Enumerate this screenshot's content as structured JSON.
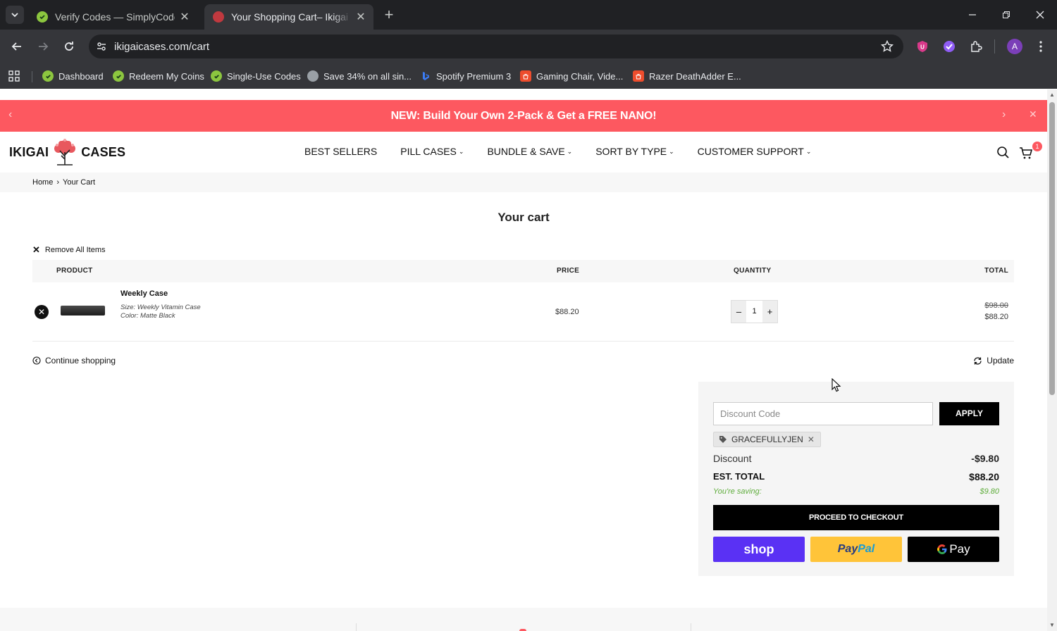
{
  "browser": {
    "tabs": [
      {
        "title": "Verify Codes — SimplyCodes",
        "active": false,
        "favicon": "simplycodes-check-icon"
      },
      {
        "title": "Your Shopping Cart– Ikigai Case",
        "active": true,
        "favicon": "ikigai-tree-icon"
      }
    ],
    "url": "ikigaicases.com/cart",
    "bookmarks": [
      {
        "label": "Dashboard",
        "icon": "simplycodes-check-icon"
      },
      {
        "label": "Redeem My Coins",
        "icon": "simplycodes-check-icon"
      },
      {
        "label": "Single-Use Codes",
        "icon": "simplycodes-check-icon"
      },
      {
        "label": "Save 34% on all sin...",
        "icon": "globe-icon"
      },
      {
        "label": "Spotify Premium 3",
        "icon": "bing-icon"
      },
      {
        "label": "Gaming Chair, Vide...",
        "icon": "shop-bag-icon"
      },
      {
        "label": "Razer DeathAdder E...",
        "icon": "shop-bag-icon"
      }
    ],
    "profile_initial": "A"
  },
  "announcement": {
    "text": "NEW: Build Your Own 2-Pack & Get a FREE NANO!"
  },
  "header": {
    "logo_left": "IKIGAI",
    "logo_right": "CASES",
    "nav": [
      {
        "label": "BEST SELLERS",
        "dropdown": false
      },
      {
        "label": "PILL CASES",
        "dropdown": true
      },
      {
        "label": "BUNDLE & SAVE",
        "dropdown": true
      },
      {
        "label": "SORT BY TYPE",
        "dropdown": true
      },
      {
        "label": "CUSTOMER SUPPORT",
        "dropdown": true
      }
    ],
    "cart_count": "1"
  },
  "breadcrumb": {
    "home": "Home",
    "sep": "›",
    "current": "Your Cart"
  },
  "cart": {
    "title": "Your cart",
    "remove_all": "Remove All Items",
    "columns": {
      "product": "PRODUCT",
      "price": "PRICE",
      "quantity": "QUANTITY",
      "total": "TOTAL"
    },
    "items": [
      {
        "name": "Weekly Case",
        "size": "Size: Weekly Vitamin Case",
        "color": "Color: Matte Black",
        "price": "$88.20",
        "quantity": "1",
        "original_total": "$98.00",
        "total": "$88.20"
      }
    ],
    "continue_shopping": "Continue shopping",
    "update": "Update"
  },
  "summary": {
    "discount_placeholder": "Discount Code",
    "discount_value": "",
    "apply": "APPLY",
    "applied_code": "GRACEFULLYJEN",
    "discount_label": "Discount",
    "discount_value_text": "-$9.80",
    "total_label": "EST. TOTAL",
    "total_value": "$88.20",
    "saving_label": "You're saving:",
    "saving_value": "$9.80",
    "checkout": "PROCEED TO CHECKOUT",
    "pay_shop": "shop",
    "pay_paypal_a": "Pay",
    "pay_paypal_b": "Pal",
    "pay_gpay": "Pay"
  },
  "colors": {
    "accent": "#fd5860",
    "saving_green": "#5fad3c",
    "shop_pay": "#5a31f4",
    "paypal": "#ffc439"
  }
}
